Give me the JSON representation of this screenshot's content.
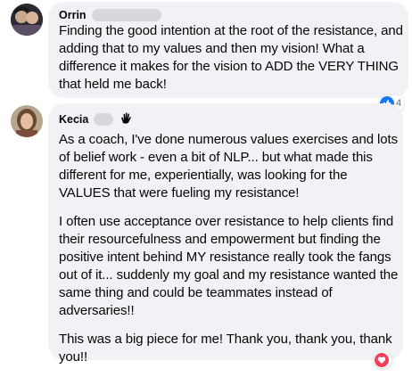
{
  "comments": [
    {
      "author": "Orrin",
      "paragraphs": [
        "Finding the good intention at the root of the resistance, and adding that to my values and then my vision! What a difference it makes for the vision to ADD the VERY THING that held me back!"
      ],
      "reaction": {
        "icon": "like-icon",
        "count": "4",
        "color": "#1877f2"
      }
    },
    {
      "author": "Kecia",
      "badge_icon": "waving-hand-icon",
      "paragraphs": [
        "As a coach, I've done numerous values exercises and lots of belief work - even a bit of NLP... but what made this different for me, experientially, was looking for the VALUES that were fueling my resistance!",
        "I often use acceptance over resistance to help clients find their resourcefulness and empowerment but finding the positive intent behind MY resistance really took the fangs out of it... suddenly my goal and my resistance wanted the same thing and could be teammates instead of adversaries!!",
        "This was a big piece for me! Thank you, thank you, thank you!!"
      ],
      "reaction": {
        "icon": "love-icon",
        "color": "#f33e58"
      }
    }
  ]
}
